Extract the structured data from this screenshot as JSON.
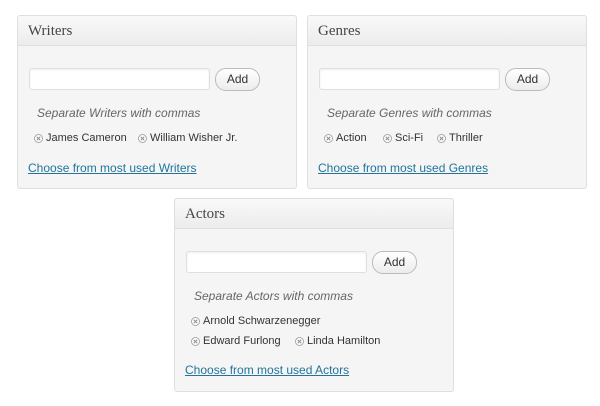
{
  "writers": {
    "title": "Writers",
    "add_label": "Add",
    "hint": "Separate Writers with commas",
    "tags": [
      "James Cameron",
      "William Wisher Jr."
    ],
    "link": "Choose from most used Writers"
  },
  "genres": {
    "title": "Genres",
    "add_label": "Add",
    "hint": "Separate Genres with commas",
    "tags": [
      "Action",
      "Sci-Fi",
      "Thriller"
    ],
    "link": "Choose from most used Genres"
  },
  "actors": {
    "title": "Actors",
    "add_label": "Add",
    "hint": "Separate Actors with commas",
    "tags": [
      "Arnold Schwarzenegger",
      "Edward Furlong",
      "Linda Hamilton"
    ],
    "link": "Choose from most used Actors"
  },
  "colors": {
    "link": "#21759b",
    "panel_background": "#f5f5f5",
    "panel_border": "#dfdfdf"
  }
}
